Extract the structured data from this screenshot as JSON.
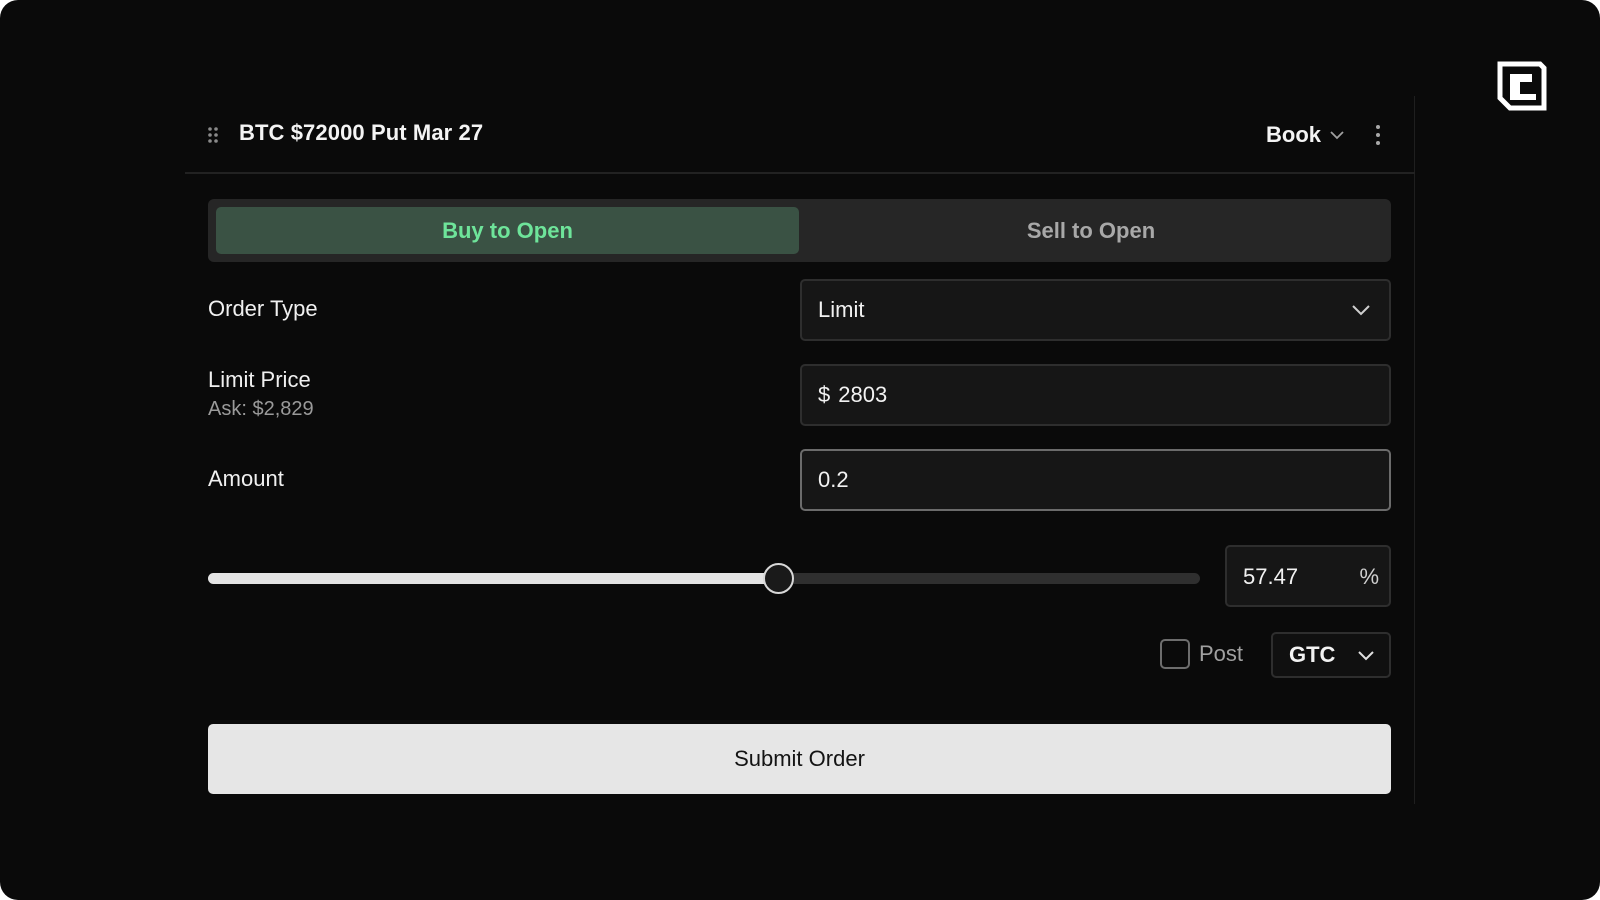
{
  "header": {
    "title": "BTC $72000 Put Mar 27",
    "view_select": "Book"
  },
  "side_toggle": {
    "buy_label": "Buy to Open",
    "sell_label": "Sell to Open",
    "selected": "Buy to Open"
  },
  "order_type": {
    "label": "Order Type",
    "value": "Limit"
  },
  "limit_price": {
    "label": "Limit Price",
    "ask_text": "Ask: $2,829",
    "prefix": "$",
    "value": "2803"
  },
  "amount": {
    "label": "Amount",
    "value": "0.2"
  },
  "slider": {
    "percent": 57.47,
    "percent_text": "57.47",
    "unit": "%"
  },
  "post": {
    "label": "Post",
    "checked": false
  },
  "time_in_force": {
    "value": "GTC"
  },
  "submit": {
    "label": "Submit Order"
  },
  "colors": {
    "background": "#0a0a0a",
    "buy_active_bg": "#3a5244",
    "buy_active_text": "#6ee49a",
    "submit_bg": "#e6e6e6"
  },
  "icons": {
    "drag": "drag-handle-icon",
    "view_chevron": "chevron-down-icon",
    "more": "more-vertical-icon",
    "logo": "app-logo-icon"
  }
}
